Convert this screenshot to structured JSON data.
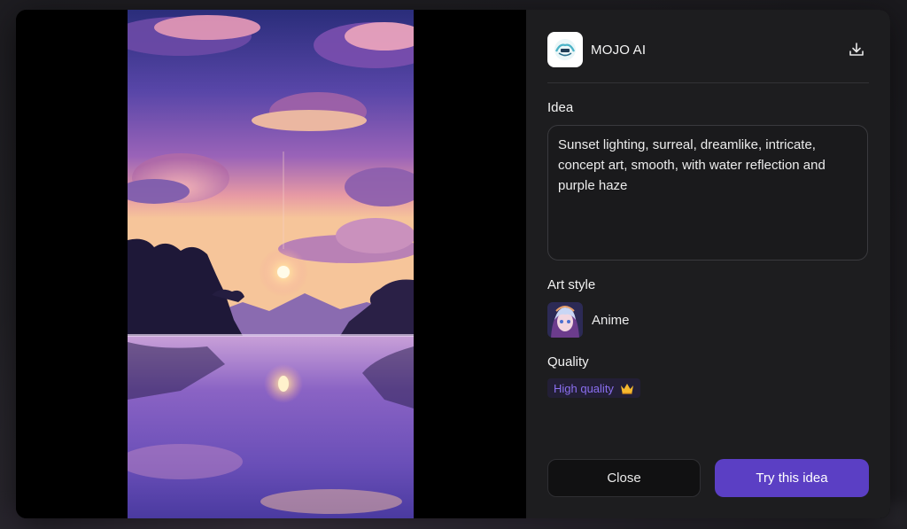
{
  "app": {
    "name": "MOJO AI",
    "logo_icon": "mojo-ai-logo"
  },
  "labels": {
    "idea": "Idea",
    "art_style": "Art style",
    "quality": "Quality"
  },
  "idea_text": "Sunset lighting, surreal, dreamlike, intricate, concept art, smooth, with water reflection and purple haze",
  "art_style": {
    "name": "Anime",
    "thumbnail_icon": "anime-girl-thumbnail"
  },
  "quality": {
    "value": "High quality",
    "icon": "crown-icon",
    "color": "#8b6ff0"
  },
  "buttons": {
    "close": "Close",
    "try": "Try this idea"
  },
  "colors": {
    "accent": "#5b3fc4",
    "panel_bg": "#1d1d1f"
  }
}
